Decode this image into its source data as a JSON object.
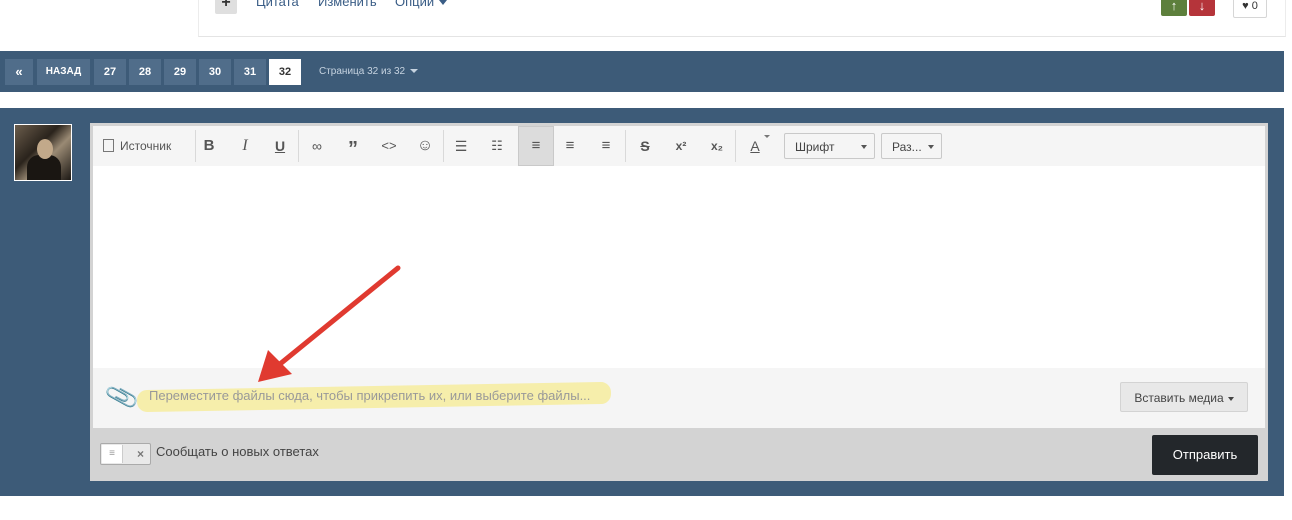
{
  "post_actions": {
    "plus_label": "+",
    "quote_label": "Цитата",
    "edit_label": "Изменить",
    "options_label": "Опции",
    "vote_up_icon": "arrow-up-icon",
    "vote_down_icon": "arrow-down-icon",
    "like_count": "0"
  },
  "pagination": {
    "first_icon": "«",
    "back_label": "НАЗАД",
    "pages": [
      "27",
      "28",
      "29",
      "30",
      "31",
      "32"
    ],
    "current_page": "32",
    "page_of_label": "Страница 32 из 32"
  },
  "editor": {
    "source_label": "Источник",
    "bold": "B",
    "italic": "I",
    "underline": "U",
    "link_icon": "∞",
    "quote_icon": "”",
    "code_icon": "<>",
    "smile_icon": "☺",
    "strike": "S",
    "sup": "x²",
    "sub": "x₂",
    "color": "A",
    "font_select": "Шрифт",
    "size_select": "Раз...",
    "attach_placeholder": "Переместите файлы сюда, чтобы прикрепить их, или выберите файлы...",
    "insert_media_label": "Вставить медиа"
  },
  "footer": {
    "notify_label": "Сообщать о новых ответах",
    "submit_label": "Отправить"
  },
  "colors": {
    "bar_bg": "#3d5b78",
    "highlight": "#f6ec9e",
    "arrow": "#e03a30",
    "vote_up": "#5d7f3c",
    "vote_down": "#b5343a"
  }
}
